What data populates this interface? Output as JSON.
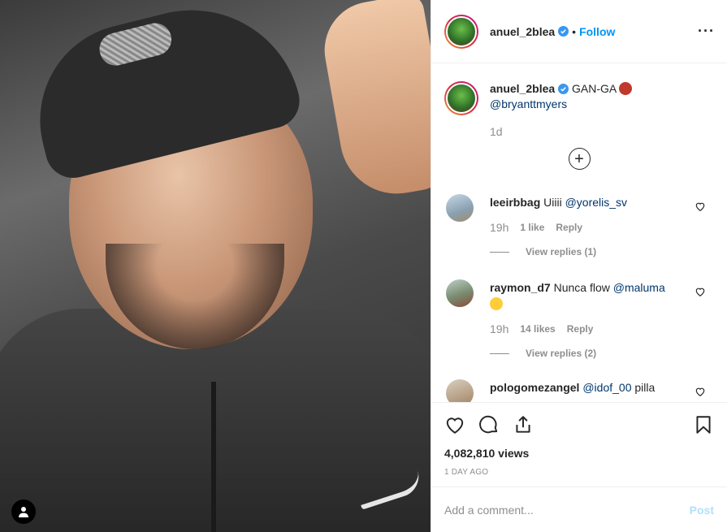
{
  "post": {
    "username": "anuel_2blea",
    "follow_label": "Follow",
    "dot": "•",
    "more_label": "···"
  },
  "caption": {
    "username": "anuel_2blea",
    "text": "GAN-GA",
    "mention": "@bryanttmyers",
    "time": "1d",
    "load_more": "+"
  },
  "comments": [
    {
      "username": "leeirbbag",
      "text": "Uiiii ",
      "mention": "@yorelis_sv",
      "time": "19h",
      "likes": "1 like",
      "reply": "Reply",
      "view_replies": "View replies (1)"
    },
    {
      "username": "raymon_d7",
      "text": "Nunca flow ",
      "mention": "@maluma",
      "time": "19h",
      "likes": "14 likes",
      "reply": "Reply",
      "view_replies": "View replies (2)"
    },
    {
      "username": "pologomezangel",
      "text": " pilla",
      "mention": "@idof_00"
    }
  ],
  "stats": {
    "views": "4,082,810 views",
    "ago": "1 day ago"
  },
  "add_comment": {
    "placeholder": "Add a comment...",
    "post_label": "Post"
  },
  "icons": [
    "user-tag-icon",
    "verified-badge-icon",
    "more-options-icon",
    "heart-icon",
    "comment-icon",
    "share-icon",
    "bookmark-icon",
    "add-circle-icon"
  ],
  "colors": {
    "accent": "#0095f6",
    "mention": "#00376b",
    "muted": "#8e8e8e",
    "post_disabled": "#b2dffc"
  }
}
